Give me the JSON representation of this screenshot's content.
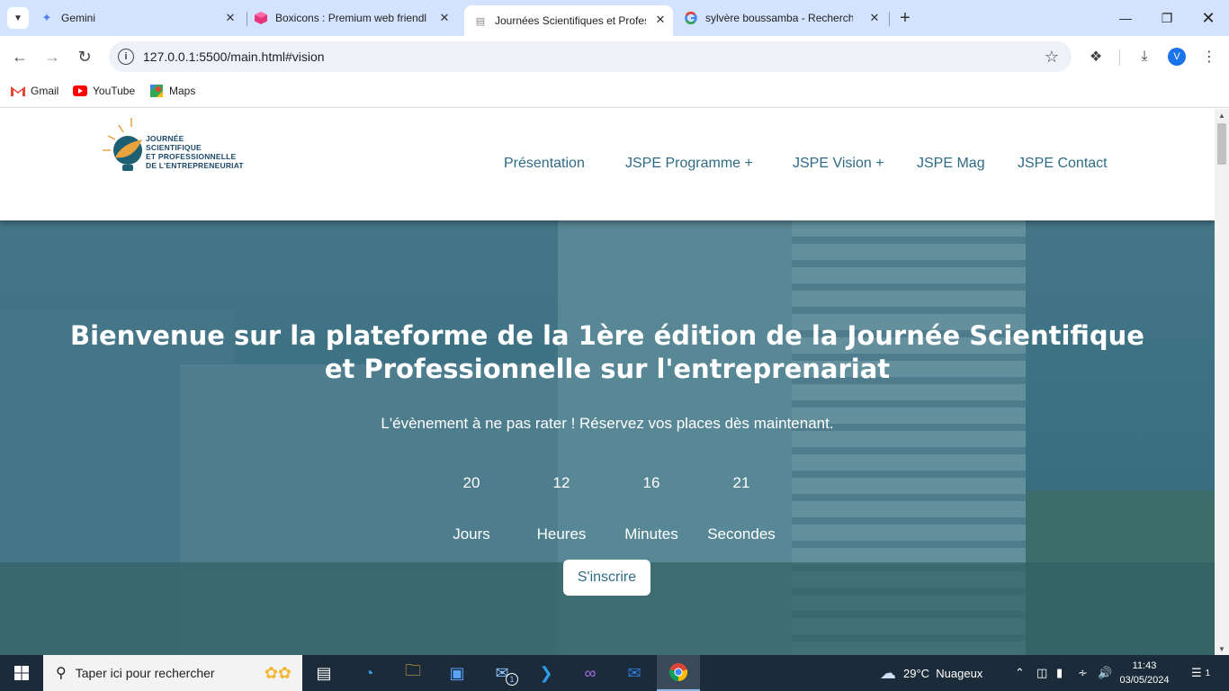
{
  "browser": {
    "tabs": [
      {
        "title": "Gemini",
        "icon": "gemini-sparkle"
      },
      {
        "title": "Boxicons : Premium web friendl",
        "icon": "boxicons-cube"
      },
      {
        "title": "Journées Scientifiques et Profes",
        "icon": "site-favicon"
      },
      {
        "title": "sylvère boussamba - Recherche",
        "icon": "google-g"
      }
    ],
    "url": "127.0.0.1:5500/main.html#vision",
    "profile_initial": "V",
    "bookmarks": [
      "Gmail",
      "YouTube",
      "Maps"
    ]
  },
  "site": {
    "logo_lines": [
      "JOURNÉE",
      "SCIENTIFIQUE",
      "ET PROFESSIONNELLE",
      "DE L'ENTREPRENEURIAT"
    ],
    "nav": [
      "Présentation",
      "JSPE Programme +",
      "JSPE Vision +",
      "JSPE Mag",
      "JSPE Contact"
    ],
    "hero": {
      "title": "Bienvenue sur la plateforme de la 1ère édition de la Journée Scientifique et Professionnelle sur l'entreprenariat",
      "subtitle": "L'évènement à ne pas rater ! Réservez vos places dès maintenant.",
      "countdown": [
        {
          "value": "20",
          "label": "Jours"
        },
        {
          "value": "12",
          "label": "Heures"
        },
        {
          "value": "16",
          "label": "Minutes"
        },
        {
          "value": "21",
          "label": "Secondes"
        }
      ],
      "cta": "S'inscrire"
    }
  },
  "taskbar": {
    "search_placeholder": "Taper ici pour rechercher",
    "weather": "29°C  Nuageux",
    "time": "11:43",
    "date": "03/05/2024",
    "mail_badge": "1",
    "notifications": "1"
  },
  "colors": {
    "accent": "#2e6b85",
    "tabstrip": "#d3e3fd",
    "hero_overlay": "#3f7686",
    "taskbar": "#1c2b3a"
  }
}
